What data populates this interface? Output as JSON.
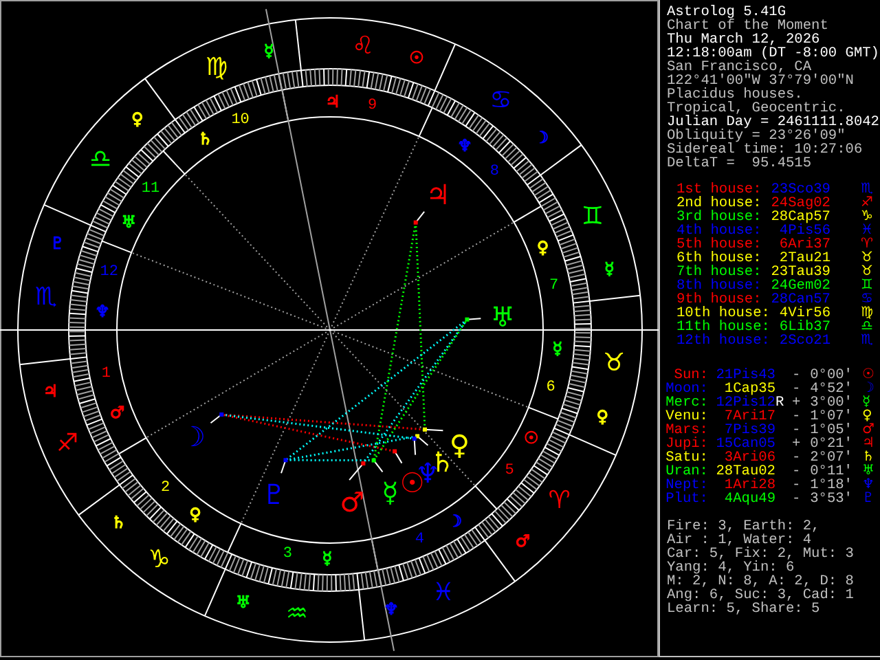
{
  "info_lines": [
    {
      "text": "Astrolog 5.41G",
      "bright": true
    },
    {
      "text": "Chart of the Moment",
      "bright": false
    },
    {
      "text": "Thu March 12, 2026",
      "bright": true
    },
    {
      "text": "12:18:00am (DT -8:00 GMT)",
      "bright": true
    },
    {
      "text": "San Francisco, CA",
      "bright": false
    },
    {
      "text": "122°41'00\"W 37°79'00\"N",
      "bright": false
    },
    {
      "text": "Placidus houses.",
      "bright": false
    },
    {
      "text": "Tropical, Geocentric.",
      "bright": false
    },
    {
      "text": "Julian Day = 2461111.8042",
      "bright": true
    },
    {
      "text": "Obliquity = 23°26'09\"",
      "bright": false
    },
    {
      "text": "Sidereal time: 10:27:06",
      "bright": false
    },
    {
      "text": "DeltaT =  95.4515",
      "bright": false
    }
  ],
  "houses": [
    {
      "label": "1st house:",
      "position": {
        "text": "23Sco39",
        "color": "#0000ff"
      },
      "glyph": "♏",
      "color": "#ff0000"
    },
    {
      "label": "2nd house:",
      "position": {
        "text": "24Sag02",
        "color": "#ff0000"
      },
      "glyph": "♐",
      "color": "#ffff00"
    },
    {
      "label": "3rd house:",
      "position": {
        "text": "28Cap57",
        "color": "#ffff00"
      },
      "glyph": "♑",
      "color": "#00ff00"
    },
    {
      "label": "4th house:",
      "position": {
        "text": "4Pis56",
        "color": "#0000ff"
      },
      "glyph": "♓",
      "color": "#0000ff"
    },
    {
      "label": "5th house:",
      "position": {
        "text": "6Ari37",
        "color": "#ff0000"
      },
      "glyph": "♈",
      "color": "#ff0000"
    },
    {
      "label": "6th house:",
      "position": {
        "text": "2Tau21",
        "color": "#ffff00"
      },
      "glyph": "♉",
      "color": "#ffff00"
    },
    {
      "label": "7th house:",
      "position": {
        "text": "23Tau39",
        "color": "#ffff00"
      },
      "glyph": "♉",
      "color": "#00ff00"
    },
    {
      "label": "8th house:",
      "position": {
        "text": "24Gem02",
        "color": "#00ff00"
      },
      "glyph": "♊",
      "color": "#0000ff"
    },
    {
      "label": "9th house:",
      "position": {
        "text": "28Can57",
        "color": "#0000ff"
      },
      "glyph": "♋",
      "color": "#ff0000"
    },
    {
      "label": "10th house:",
      "position": {
        "text": "4Vir56",
        "color": "#ffff00"
      },
      "glyph": "♍",
      "color": "#ffff00"
    },
    {
      "label": "11th house:",
      "position": {
        "text": "6Lib37",
        "color": "#00ff00"
      },
      "glyph": "♎",
      "color": "#00ff00"
    },
    {
      "label": "12th house:",
      "position": {
        "text": "2Sco21",
        "color": "#0000ff"
      },
      "glyph": "♏",
      "color": "#0000ff"
    }
  ],
  "planets": [
    {
      "name": "Sun:",
      "position": {
        "text": "21Pis43",
        "color": "#0000ff"
      },
      "direction": "-",
      "offset": "0°00'",
      "glyph": "☉",
      "color": "#ff0000"
    },
    {
      "name": "Moon:",
      "position": {
        "text": "1Cap35",
        "color": "#ffff00"
      },
      "direction": "-",
      "offset": "4°52'",
      "glyph": "☽",
      "color": "#0000ff"
    },
    {
      "name": "Merc:",
      "position": {
        "text": "12Pis12",
        "color": "#0000ff"
      },
      "flag": "R",
      "direction": "+",
      "offset": "3°00'",
      "glyph": "☿",
      "color": "#00ff00"
    },
    {
      "name": "Venu:",
      "position": {
        "text": "7Ari17",
        "color": "#ff0000"
      },
      "direction": "-",
      "offset": "1°07'",
      "glyph": "♀",
      "color": "#ffff00"
    },
    {
      "name": "Mars:",
      "position": {
        "text": "7Pis39",
        "color": "#0000ff"
      },
      "direction": "-",
      "offset": "1°05'",
      "glyph": "♂",
      "color": "#ff0000"
    },
    {
      "name": "Jupi:",
      "position": {
        "text": "15Can05",
        "color": "#0000ff"
      },
      "direction": "+",
      "offset": "0°21'",
      "glyph": "♃",
      "color": "#ff0000"
    },
    {
      "name": "Satu:",
      "position": {
        "text": "3Ari06",
        "color": "#ff0000"
      },
      "direction": "-",
      "offset": "2°07'",
      "glyph": "♄",
      "color": "#ffff00"
    },
    {
      "name": "Uran:",
      "position": {
        "text": "28Tau02",
        "color": "#ffff00"
      },
      "direction": "-",
      "offset": "0°11'",
      "glyph": "♅",
      "color": "#00ff00"
    },
    {
      "name": "Nept:",
      "position": {
        "text": "1Ari28",
        "color": "#ff0000"
      },
      "direction": "-",
      "offset": "1°18'",
      "glyph": "♆",
      "color": "#0000ff"
    },
    {
      "name": "Plut:",
      "position": {
        "text": "4Aqu49",
        "color": "#00ff00"
      },
      "direction": "-",
      "offset": "3°53'",
      "glyph": "♇",
      "color": "#0000ff"
    }
  ],
  "stats": [
    "Fire: 3, Earth: 2,",
    "Air : 1, Water: 4",
    "Car: 5, Fix: 2, Mut: 3",
    "Yang: 4, Yin: 6",
    "M: 2, N: 8, A: 2, D: 8",
    "Ang: 6, Suc: 3, Cad: 1",
    "Learn: 5, Share: 5"
  ],
  "wheel": {
    "signs": [
      {
        "glyph": "♈",
        "color": "#ff0000",
        "ruler": {
          "glyph": "♂",
          "color": "#ff0000"
        }
      },
      {
        "glyph": "♉",
        "color": "#ffff00",
        "ruler": {
          "glyph": "♀",
          "color": "#ffff00"
        }
      },
      {
        "glyph": "♊",
        "color": "#00ff00",
        "ruler": {
          "glyph": "☿",
          "color": "#00ff00"
        }
      },
      {
        "glyph": "♋",
        "color": "#0000ff",
        "ruler": {
          "glyph": "☽",
          "color": "#0000ff"
        }
      },
      {
        "glyph": "♌",
        "color": "#ff0000",
        "ruler": {
          "glyph": "☉",
          "color": "#ff0000"
        }
      },
      {
        "glyph": "♍",
        "color": "#ffff00",
        "ruler": {
          "glyph": "☿",
          "color": "#00ff00"
        }
      },
      {
        "glyph": "♎",
        "color": "#00ff00",
        "ruler": {
          "glyph": "♀",
          "color": "#ffff00"
        }
      },
      {
        "glyph": "♏",
        "color": "#0000ff",
        "ruler": {
          "glyph": "♇",
          "color": "#0000ff"
        }
      },
      {
        "glyph": "♐",
        "color": "#ff0000",
        "ruler": {
          "glyph": "♃",
          "color": "#ff0000"
        }
      },
      {
        "glyph": "♑",
        "color": "#ffff00",
        "ruler": {
          "glyph": "♄",
          "color": "#ffff00"
        }
      },
      {
        "glyph": "♒",
        "color": "#00ff00",
        "ruler": {
          "glyph": "♅",
          "color": "#00ff00"
        }
      },
      {
        "glyph": "♓",
        "color": "#0000ff",
        "ruler": {
          "glyph": "♆",
          "color": "#0000ff"
        }
      }
    ],
    "houses": [
      {
        "number": "1",
        "color": "#ff0000",
        "ruler": {
          "glyph": "♂",
          "color": "#ff0000"
        }
      },
      {
        "number": "2",
        "color": "#ffff00",
        "ruler": {
          "glyph": "♀",
          "color": "#ffff00"
        }
      },
      {
        "number": "3",
        "color": "#00ff00",
        "ruler": {
          "glyph": "☿",
          "color": "#00ff00"
        }
      },
      {
        "number": "4",
        "color": "#0000ff",
        "ruler": {
          "glyph": "☽",
          "color": "#0000ff"
        }
      },
      {
        "number": "5",
        "color": "#ff0000",
        "ruler": {
          "glyph": "☉",
          "color": "#ff0000"
        }
      },
      {
        "number": "6",
        "color": "#ffff00",
        "ruler": {
          "glyph": "☿",
          "color": "#00ff00"
        }
      },
      {
        "number": "7",
        "color": "#00ff00",
        "ruler": {
          "glyph": "♀",
          "color": "#ffff00"
        }
      },
      {
        "number": "8",
        "color": "#0000ff",
        "ruler": {
          "glyph": "♆",
          "color": "#0000ff"
        }
      },
      {
        "number": "9",
        "color": "#ff0000",
        "ruler": {
          "glyph": "♃",
          "color": "#ff0000"
        }
      },
      {
        "number": "10",
        "color": "#ffff00",
        "ruler": {
          "glyph": "♄",
          "color": "#ffff00"
        }
      },
      {
        "number": "11",
        "color": "#00ff00",
        "ruler": {
          "glyph": "♅",
          "color": "#00ff00"
        }
      },
      {
        "number": "12",
        "color": "#0000ff",
        "ruler": {
          "glyph": "♆",
          "color": "#0000ff"
        }
      }
    ],
    "planets": [
      {
        "glyph": "☉",
        "color": "#ff0000"
      },
      {
        "glyph": "☽",
        "color": "#0000ff"
      },
      {
        "glyph": "☿",
        "color": "#00ff00"
      },
      {
        "glyph": "♀",
        "color": "#ffff00"
      },
      {
        "glyph": "♂",
        "color": "#ff0000"
      },
      {
        "glyph": "♃",
        "color": "#ff0000"
      },
      {
        "glyph": "♄",
        "color": "#ffff00"
      },
      {
        "glyph": "♅",
        "color": "#00ff00"
      },
      {
        "glyph": "♆",
        "color": "#0000ff"
      },
      {
        "glyph": "♇",
        "color": "#0000ff"
      }
    ]
  }
}
